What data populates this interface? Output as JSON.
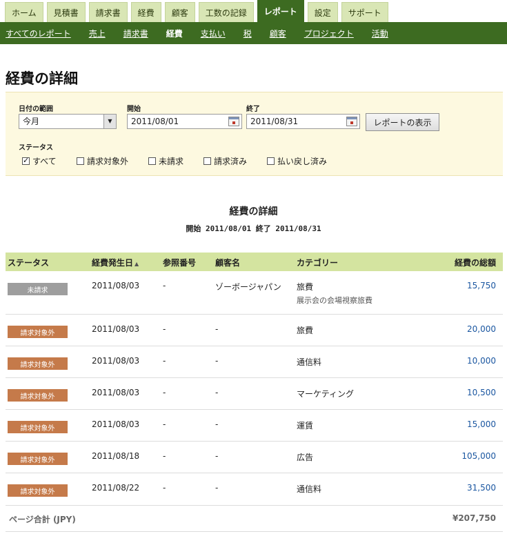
{
  "tabs": [
    "ホーム",
    "見積書",
    "請求書",
    "経費",
    "顧客",
    "工数の記録",
    "レポート",
    "設定",
    "サポート"
  ],
  "subnav": [
    "すべてのレポート",
    "売上",
    "請求書",
    "経費",
    "支払い",
    "税",
    "顧客",
    "プロジェクト",
    "活動"
  ],
  "page_title": "経費の詳細",
  "filter": {
    "range_label": "日付の範囲",
    "range_value": "今月",
    "start_label": "開始",
    "start_value": "2011/08/01",
    "end_label": "終了",
    "end_value": "2011/08/31",
    "button": "レポートの表示",
    "status_label": "ステータス",
    "statuses": [
      "すべて",
      "請求対象外",
      "未請求",
      "請求済み",
      "払い戻し済み"
    ]
  },
  "report": {
    "title": "経費の詳細",
    "range": "開始 2011/08/01 終了 2011/08/31"
  },
  "table": {
    "headers": [
      "ステータス",
      "経費発生日",
      "参照番号",
      "顧客名",
      "カテゴリー",
      "経費の総額"
    ],
    "sort_indicator": "▲",
    "rows": [
      {
        "status": "未請求",
        "date": "2011/08/03",
        "ref": "-",
        "client": "ゾーボージャパン",
        "category": "旅費",
        "note": "展示会の会場視察旅費",
        "amount": "15,750"
      },
      {
        "status": "請求対象外",
        "date": "2011/08/03",
        "ref": "-",
        "client": "-",
        "category": "旅費",
        "note": "",
        "amount": "20,000"
      },
      {
        "status": "請求対象外",
        "date": "2011/08/03",
        "ref": "-",
        "client": "-",
        "category": "通信料",
        "note": "",
        "amount": "10,000"
      },
      {
        "status": "請求対象外",
        "date": "2011/08/03",
        "ref": "-",
        "client": "-",
        "category": "マーケティング",
        "note": "",
        "amount": "10,500"
      },
      {
        "status": "請求対象外",
        "date": "2011/08/03",
        "ref": "-",
        "client": "-",
        "category": "運賃",
        "note": "",
        "amount": "15,000"
      },
      {
        "status": "請求対象外",
        "date": "2011/08/18",
        "ref": "-",
        "client": "-",
        "category": "広告",
        "note": "",
        "amount": "105,000"
      },
      {
        "status": "請求対象外",
        "date": "2011/08/22",
        "ref": "-",
        "client": "-",
        "category": "通信料",
        "note": "",
        "amount": "31,500"
      }
    ]
  },
  "total": {
    "label": "ページ合計 (JPY)",
    "value": "¥207,750"
  },
  "colors": {
    "brand_green": "#3d6b21",
    "header_green": "#d4e4a0",
    "badge_unbilled": "#9e9e9e",
    "badge_nonbillable": "#c57a4a",
    "amount_blue": "#1a56a0"
  }
}
